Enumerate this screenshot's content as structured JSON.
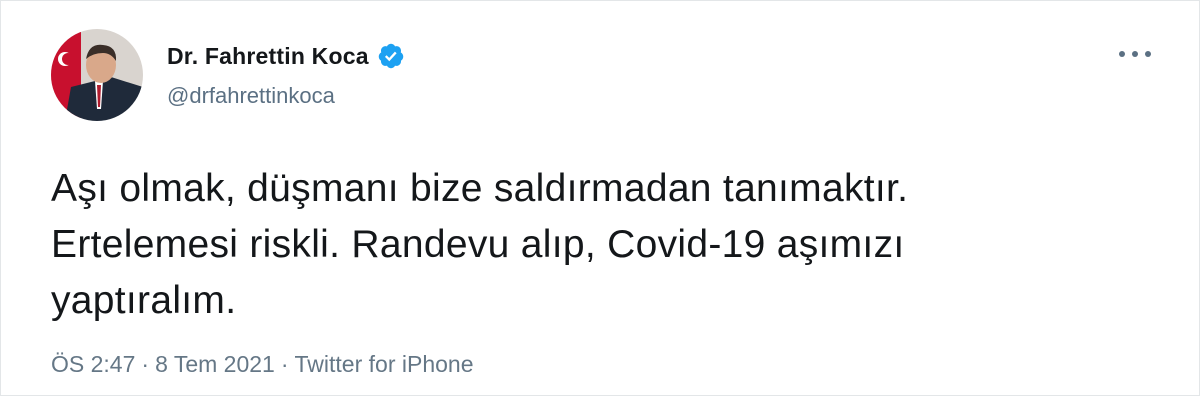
{
  "author": {
    "display_name": "Dr. Fahrettin Koca",
    "handle": "@drfahrettinkoca",
    "verified": true
  },
  "tweet": {
    "text_lines": [
      "Aşı olmak, düşmanı bize saldırmadan tanımaktır.",
      "Ertelemesi riskli. Randevu alıp, Covid-19 aşımızı",
      "yaptıralım."
    ],
    "time": "ÖS 2:47",
    "separator": "·",
    "date": "8 Tem 2021",
    "source": "Twitter for iPhone"
  },
  "icons": {
    "verified": "verified-badge-icon",
    "more": "more-options-icon"
  },
  "colors": {
    "verified_blue": "#1da1f2",
    "text_primary": "#14171a",
    "text_secondary": "#5b7083"
  }
}
